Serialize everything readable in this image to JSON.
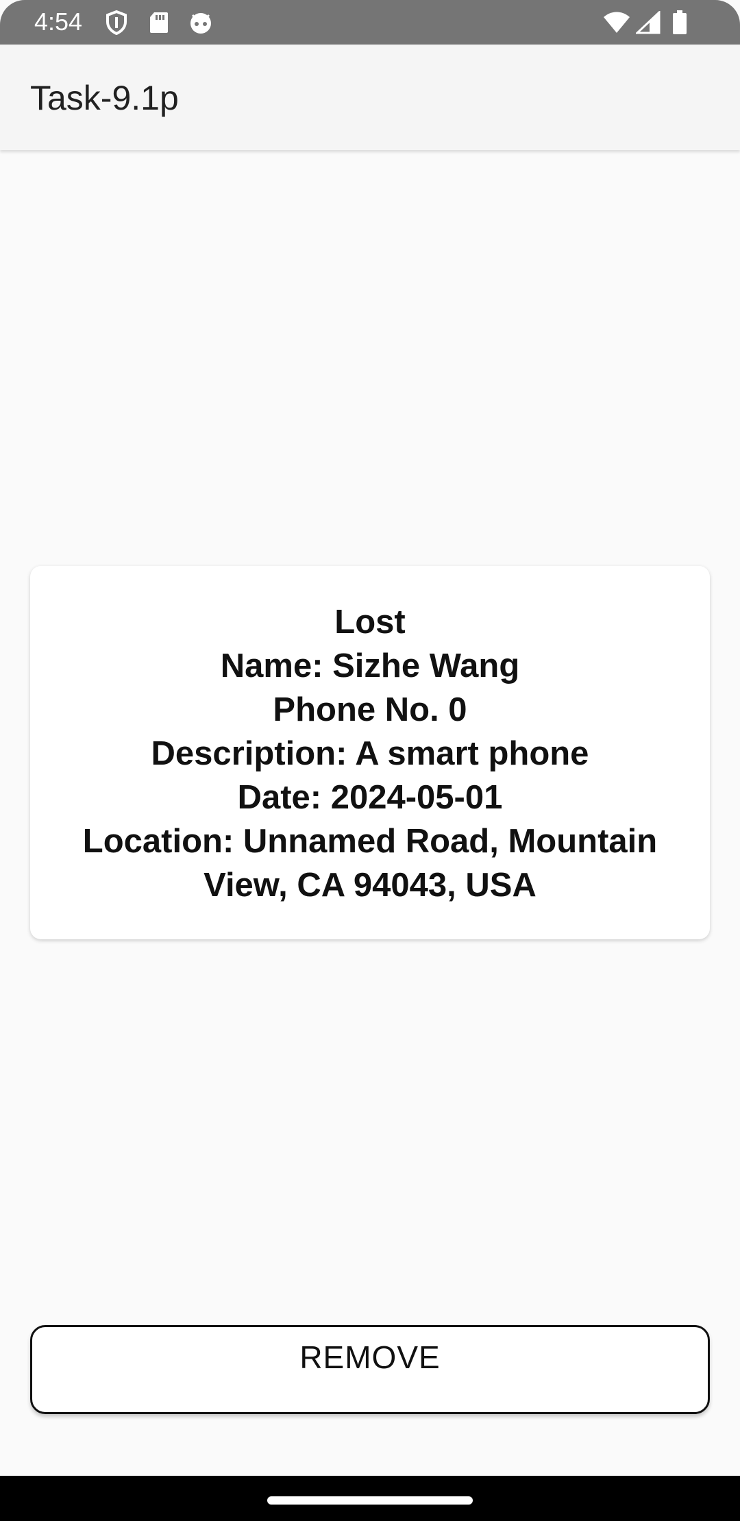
{
  "status_bar": {
    "time": "4:54",
    "left_icons": [
      "shield-icon",
      "sd-card-icon",
      "android-face-icon"
    ],
    "right_icons": [
      "wifi-icon",
      "signal-icon",
      "battery-icon"
    ]
  },
  "app_bar": {
    "title": "Task-9.1p"
  },
  "card": {
    "lines": [
      "Lost",
      "Name: Sizhe Wang",
      "Phone No. 0",
      "Description: A smart phone",
      "Date: 2024-05-01",
      "Location: Unnamed Road, Mountain",
      "View, CA 94043, USA"
    ]
  },
  "actions": {
    "remove_label": "REMOVE"
  },
  "colors": {
    "status_bar": "#757575",
    "app_bar": "#f5f5f5",
    "background": "#fafafa",
    "nav_bar": "#000000"
  }
}
